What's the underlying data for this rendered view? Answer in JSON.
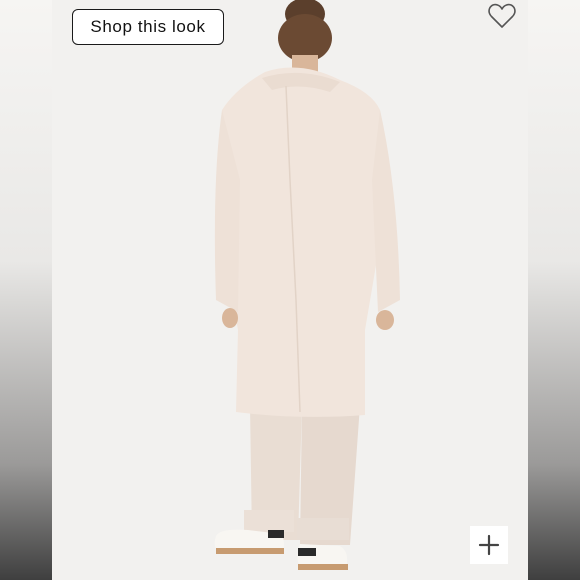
{
  "listing": {
    "shop_button_label": "Shop this look"
  },
  "icons": {
    "favorite": "heart-outline-icon",
    "zoom": "plus-icon"
  },
  "colors": {
    "coat": "#f1e5dc",
    "background": "#f2f1ef",
    "button_border": "#1a1a1a"
  }
}
